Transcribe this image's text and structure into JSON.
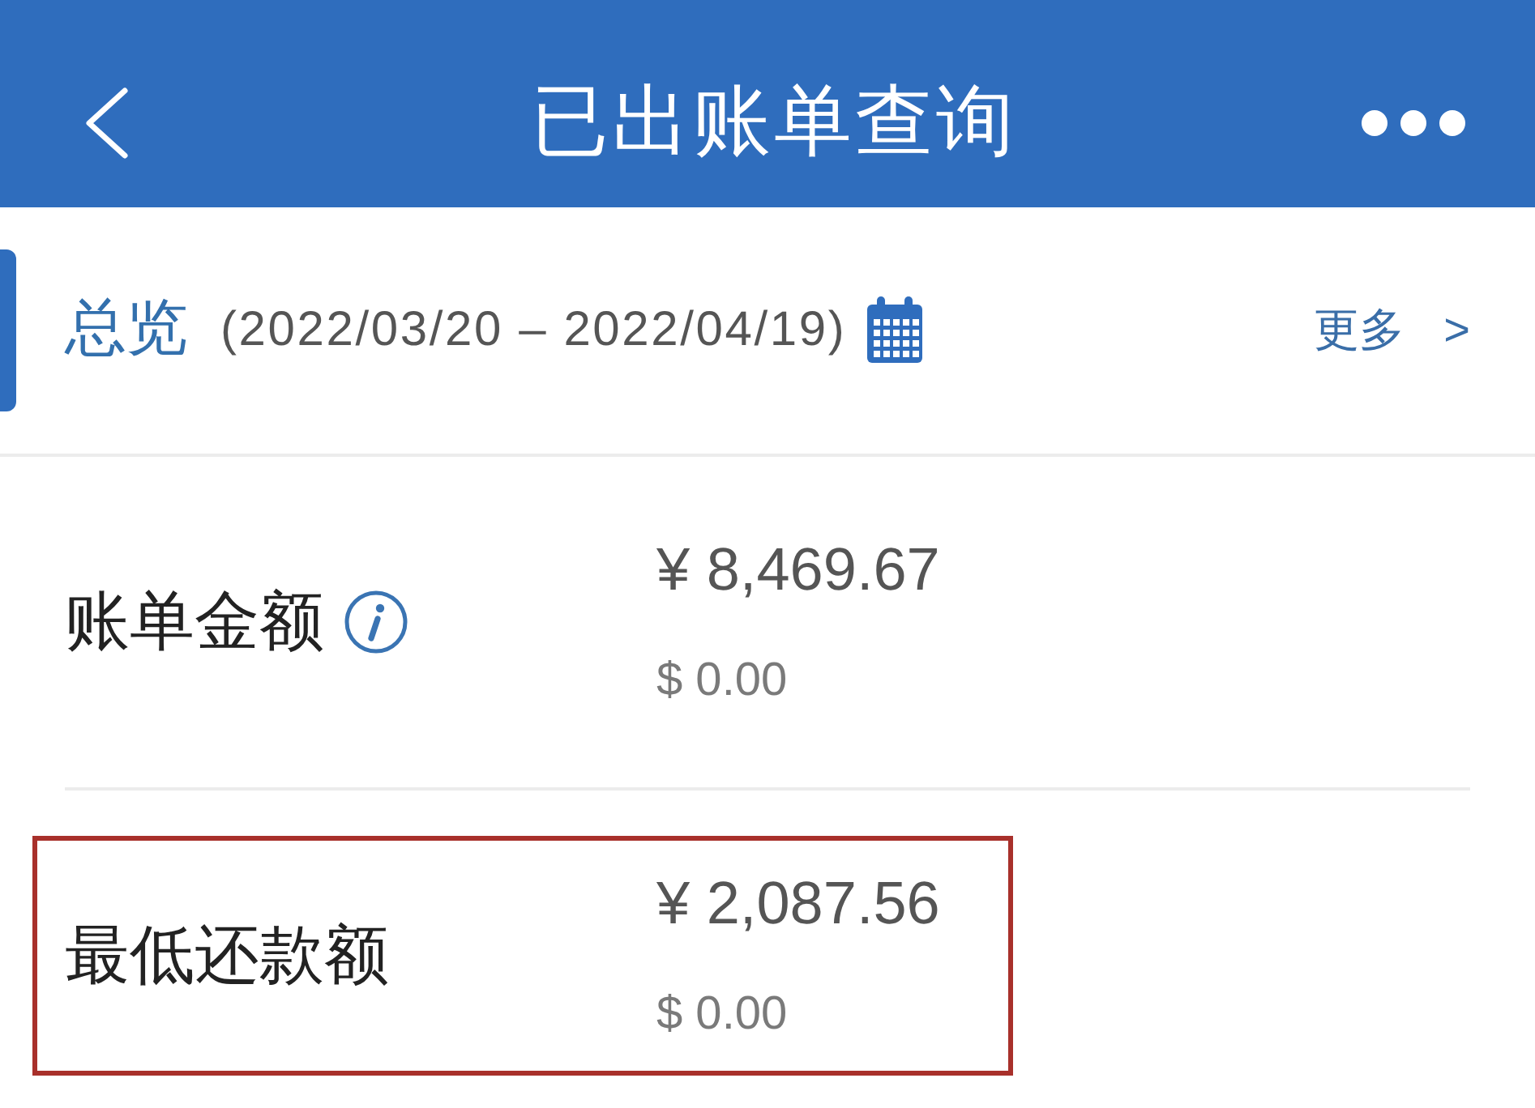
{
  "header": {
    "title": "已出账单查询"
  },
  "overview": {
    "label": "总览",
    "period": "(2022/03/20 – 2022/04/19)",
    "more": "更多",
    "more_arrow": ">"
  },
  "items": [
    {
      "label": "账单金额",
      "info": true,
      "amounts": [
        "¥ 8,469.67",
        "$ 0.00"
      ],
      "highlighted": false
    },
    {
      "label": "最低还款额",
      "info": false,
      "amounts": [
        "¥ 2,087.56",
        "$ 0.00"
      ],
      "highlighted": true
    }
  ]
}
